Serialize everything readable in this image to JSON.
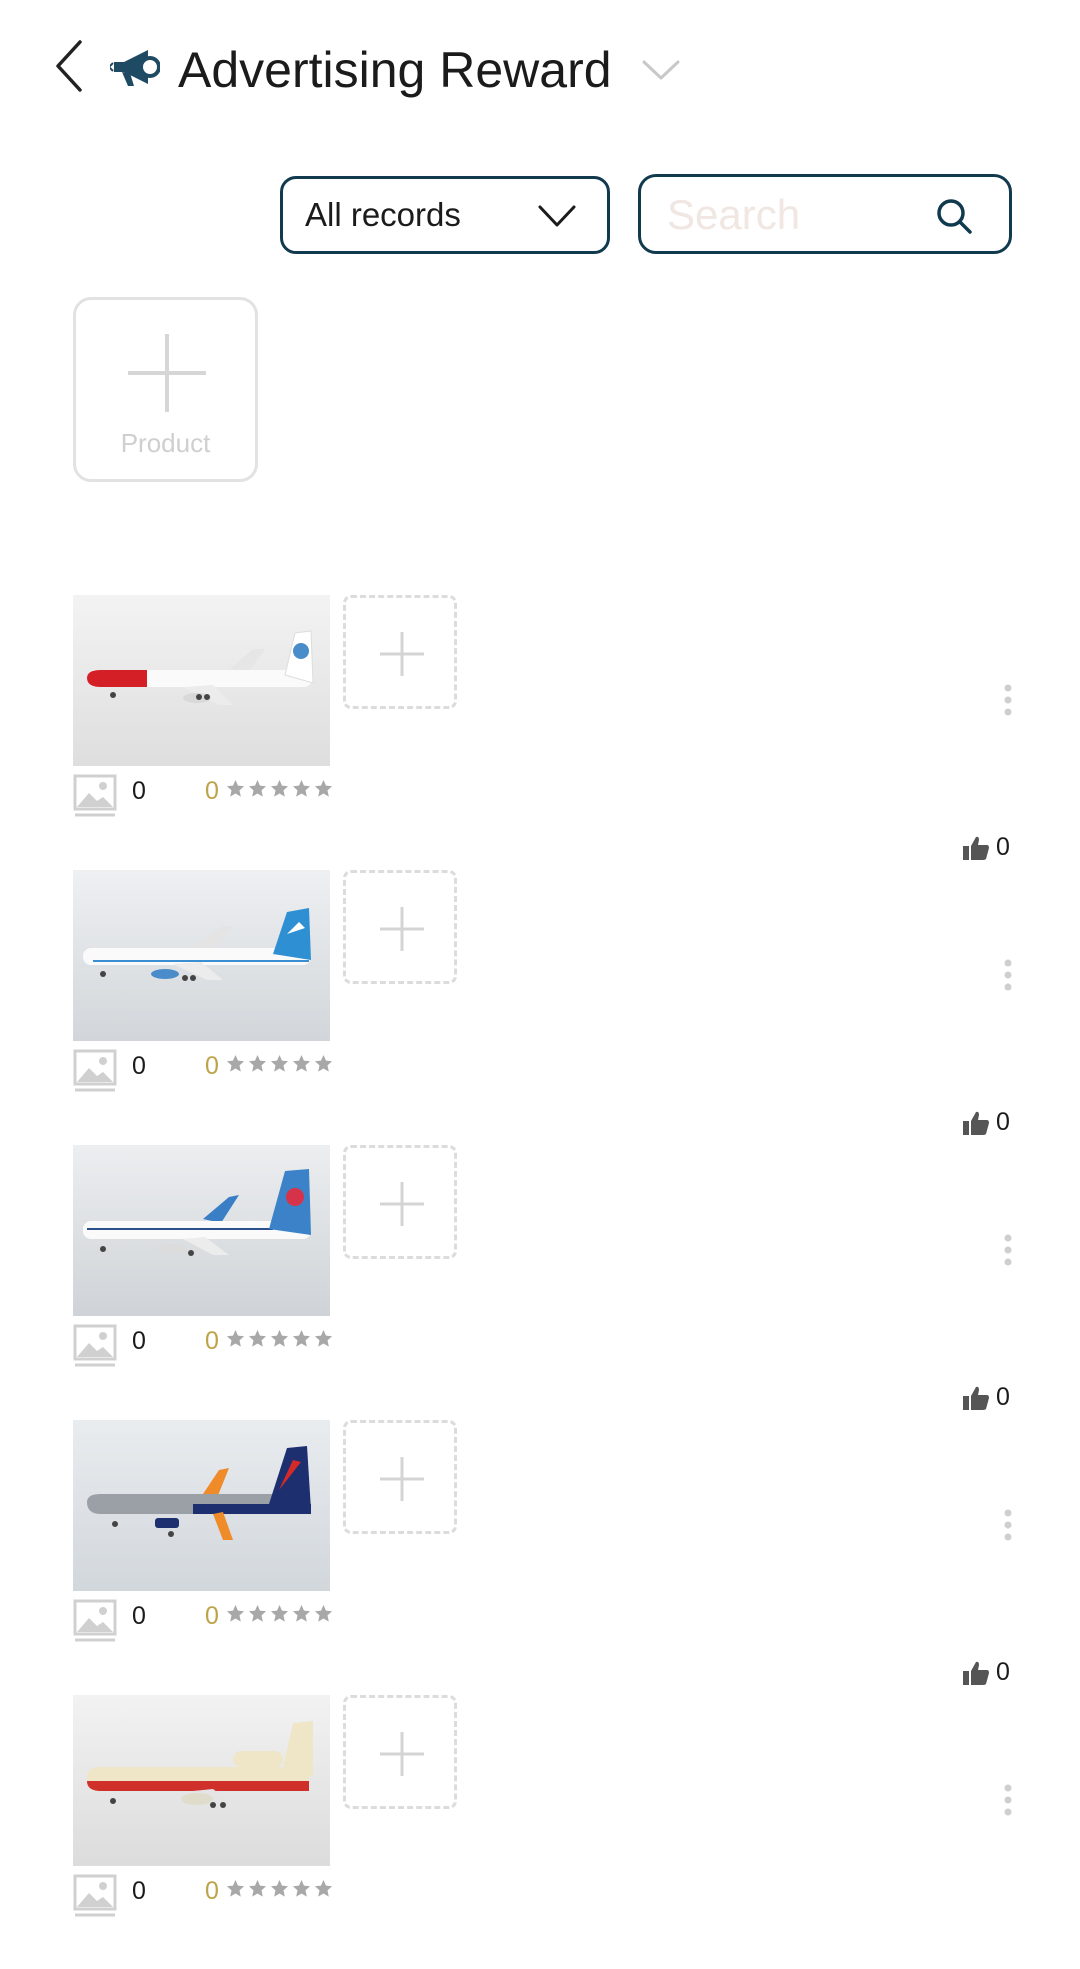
{
  "header": {
    "title": "Advertising Reward",
    "title_icon": "megaphone-icon",
    "back_icon": "chevron-left-icon",
    "dropdown_icon": "chevron-down-icon"
  },
  "filters": {
    "select_value": "All records",
    "search_placeholder": "Search",
    "search_icon": "search-icon"
  },
  "add_product": {
    "label": "Product",
    "icon": "plus-icon"
  },
  "colors": {
    "accent_border": "#123a4e",
    "rating_number": "#bda44a",
    "star_gray": "#a8a8a8"
  },
  "items": [
    {
      "image": "Norwegian airliner model (red nose, white fuselage)",
      "image_count": "0",
      "rating": "0",
      "stars": 0,
      "likes": "0"
    },
    {
      "image": "Kuwait Airways airliner model (white fuselage, blue tail)",
      "image_count": "0",
      "rating": "0",
      "stars": 0,
      "likes": "0"
    },
    {
      "image": "China Southern airliner model (white fuselage, blue tail)",
      "image_count": "0",
      "rating": "0",
      "stars": 0,
      "likes": "0"
    },
    {
      "image": "Aeroflot airliner model (grey fuselage, navy tail)",
      "image_count": "0",
      "rating": "0",
      "stars": 0,
      "likes": "0"
    },
    {
      "image": "Vintage tri-jet airliner model (cream and red livery)",
      "image_count": "0",
      "rating": "0",
      "stars": 0
    }
  ]
}
